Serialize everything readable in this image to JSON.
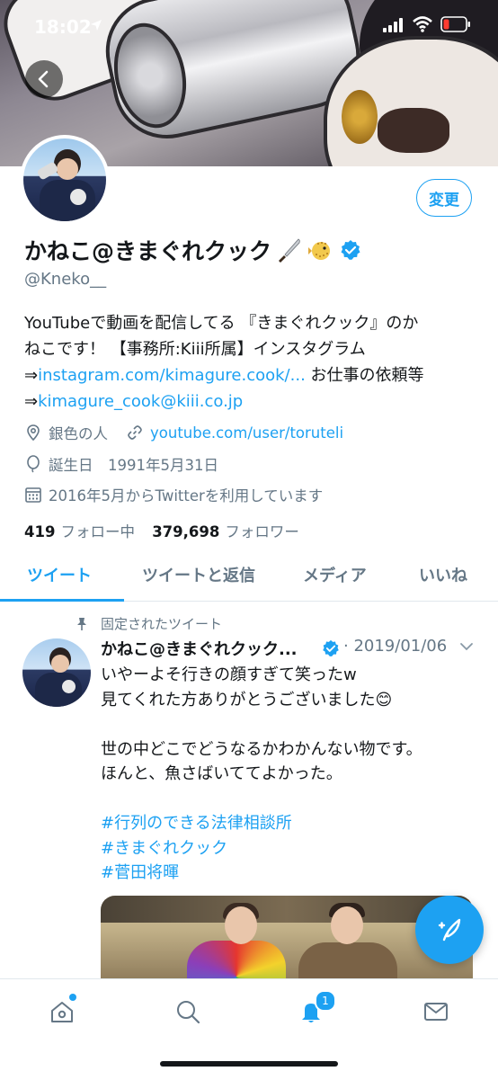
{
  "status_bar": {
    "time": "18:02"
  },
  "profile": {
    "change_button": "変更",
    "display_name": "かねこ@きまぐれクック",
    "name_emojis": [
      "knife-icon",
      "pufferfish-icon"
    ],
    "handle": "@Kneko__",
    "bio": {
      "line1": "YouTubeで動画を配信してる 『きまぐれクック』のか",
      "line2": "ねこです！ 【事務所:Kiii所属】インスタグラム",
      "arrow1": "⇒",
      "instagram_link": "instagram.com/kimagure.cook/...",
      "line3_tail": " お仕事の依頼等",
      "arrow2": "⇒",
      "email_link": "kimagure_cook@kiii.co.jp"
    },
    "location": "銀色の人",
    "website": "youtube.com/user/toruteli",
    "birthday": "誕生日　1991年5月31日",
    "joined": "2016年5月からTwitterを利用しています",
    "following_count": "419",
    "following_label": "フォロー中",
    "followers_count": "379,698",
    "followers_label": "フォロワー"
  },
  "tabs": [
    {
      "label": "ツイート",
      "active": true
    },
    {
      "label": "ツイートと返信",
      "active": false
    },
    {
      "label": "メディア",
      "active": false
    },
    {
      "label": "いいね",
      "active": false
    }
  ],
  "pinned_tweet": {
    "pinned_label": "固定されたツイート",
    "author_name": "かねこ@きまぐれクック...",
    "date": "2019/01/06",
    "text": "いやーよそ行きの顔すぎて笑ったw\n見てくれた方ありがとうございました😊\n\n世の中どこでどうなるかわかんない物です。\nほんと、魚さばいててよかった。",
    "hashtags": [
      "#行列のできる法律相談所",
      "#きまぐれクック",
      "#菅田将暉"
    ]
  },
  "bottom_nav": {
    "notification_badge": "1",
    "items": [
      "home-icon",
      "search-icon",
      "notifications-icon",
      "messages-icon"
    ]
  },
  "colors": {
    "accent": "#1da1f2",
    "text_primary": "#14171a",
    "text_secondary": "#657786",
    "divider": "#e1e8ed"
  }
}
